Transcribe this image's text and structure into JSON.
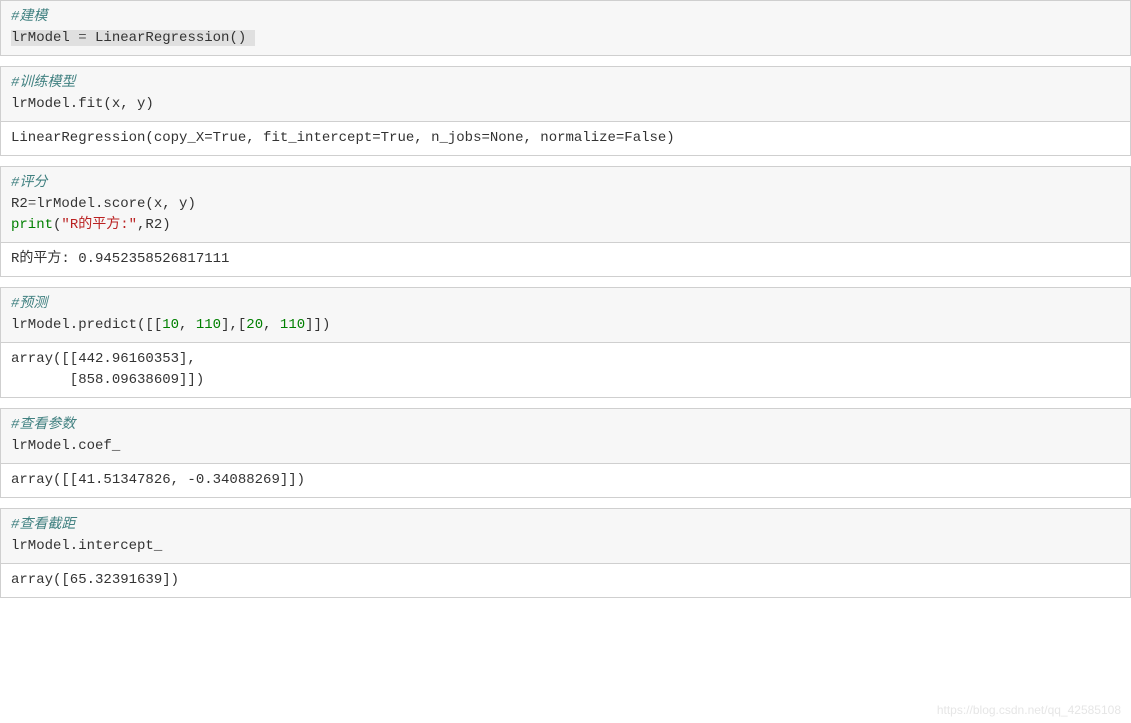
{
  "cells": [
    {
      "input": {
        "lines": [
          [
            {
              "cls": "comment",
              "t": "#建模"
            }
          ],
          [
            {
              "cls": "highlight plain",
              "t": "lrModel "
            },
            {
              "cls": "highlight op",
              "t": "="
            },
            {
              "cls": "highlight plain",
              "t": " LinearRegression() "
            }
          ]
        ]
      },
      "output": null
    },
    {
      "input": {
        "lines": [
          [
            {
              "cls": "comment",
              "t": "#训练模型"
            }
          ],
          [
            {
              "cls": "plain",
              "t": "lrModel.fit(x, y)"
            }
          ]
        ]
      },
      "output": {
        "text": "LinearRegression(copy_X=True, fit_intercept=True, n_jobs=None, normalize=False)"
      }
    },
    {
      "input": {
        "lines": [
          [
            {
              "cls": "comment",
              "t": "#评分"
            }
          ],
          [
            {
              "cls": "plain",
              "t": "R2"
            },
            {
              "cls": "op",
              "t": "="
            },
            {
              "cls": "plain",
              "t": "lrModel.score(x, y)"
            }
          ],
          [
            {
              "cls": "keyword",
              "t": "print"
            },
            {
              "cls": "plain",
              "t": "("
            },
            {
              "cls": "string",
              "t": "\"R的平方:\""
            },
            {
              "cls": "plain",
              "t": ",R2)"
            }
          ]
        ]
      },
      "output": {
        "text": "R的平方: 0.9452358526817111"
      }
    },
    {
      "input": {
        "lines": [
          [
            {
              "cls": "comment",
              "t": "#预测"
            }
          ],
          [
            {
              "cls": "plain",
              "t": "lrModel.predict([["
            },
            {
              "cls": "number",
              "t": "10"
            },
            {
              "cls": "plain",
              "t": ", "
            },
            {
              "cls": "number",
              "t": "110"
            },
            {
              "cls": "plain",
              "t": "],["
            },
            {
              "cls": "number",
              "t": "20"
            },
            {
              "cls": "plain",
              "t": ", "
            },
            {
              "cls": "number",
              "t": "110"
            },
            {
              "cls": "plain",
              "t": "]])"
            }
          ]
        ]
      },
      "output": {
        "text": "array([[442.96160353],\n       [858.09638609]])"
      }
    },
    {
      "input": {
        "lines": [
          [
            {
              "cls": "comment",
              "t": "#查看参数"
            }
          ],
          [
            {
              "cls": "plain",
              "t": "lrModel.coef_"
            }
          ]
        ]
      },
      "output": {
        "text": "array([[41.51347826, -0.34088269]])"
      }
    },
    {
      "input": {
        "lines": [
          [
            {
              "cls": "comment",
              "t": "#查看截距"
            }
          ],
          [
            {
              "cls": "plain",
              "t": "lrModel.intercept_"
            }
          ]
        ]
      },
      "output": {
        "text": "array([65.32391639])"
      }
    }
  ],
  "watermark": "https://blog.csdn.net/qq_42585108"
}
